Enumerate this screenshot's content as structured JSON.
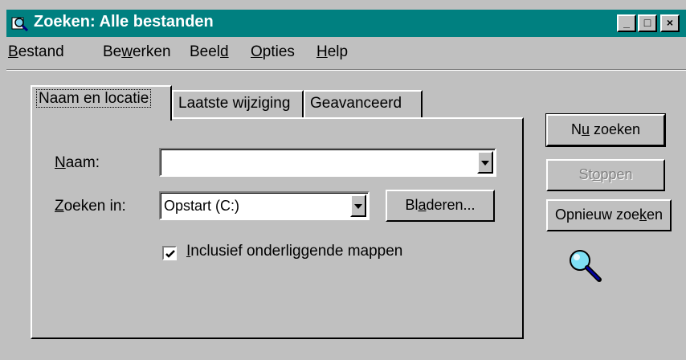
{
  "window": {
    "title": "Zoeken: Alle bestanden"
  },
  "title_buttons": {
    "minimize": "_",
    "maximize": "□",
    "close": "×"
  },
  "menu": [
    {
      "pre": "",
      "u": "B",
      "post": "estand"
    },
    {
      "pre": "Be",
      "u": "w",
      "post": "erken"
    },
    {
      "pre": "Beel",
      "u": "d",
      "post": ""
    },
    {
      "pre": "",
      "u": "O",
      "post": "pties"
    },
    {
      "pre": "",
      "u": "H",
      "post": "elp"
    }
  ],
  "tabs": [
    {
      "label": "Naam en locatie",
      "active": true
    },
    {
      "label": "Laatste wijziging",
      "active": false
    },
    {
      "label": "Geavanceerd",
      "active": false
    }
  ],
  "form": {
    "name_label": {
      "u": "N",
      "post": "aam:"
    },
    "name_value": "",
    "lookin_label": {
      "u": "Z",
      "post": "oeken in:"
    },
    "lookin_value": "Opstart (C:)",
    "browse": {
      "pre": "Bl",
      "u": "a",
      "post": "deren..."
    },
    "subfolders": {
      "u": "I",
      "post": "nclusief onderliggende mappen",
      "checked": true
    }
  },
  "actions": {
    "find_now": {
      "pre": "N",
      "u": "u",
      "post": " zoeken"
    },
    "stop": {
      "pre": "St",
      "u": "o",
      "post": "ppen",
      "disabled": true
    },
    "new_search": {
      "pre": "Opnieuw zoe",
      "u": "k",
      "post": "en"
    }
  }
}
